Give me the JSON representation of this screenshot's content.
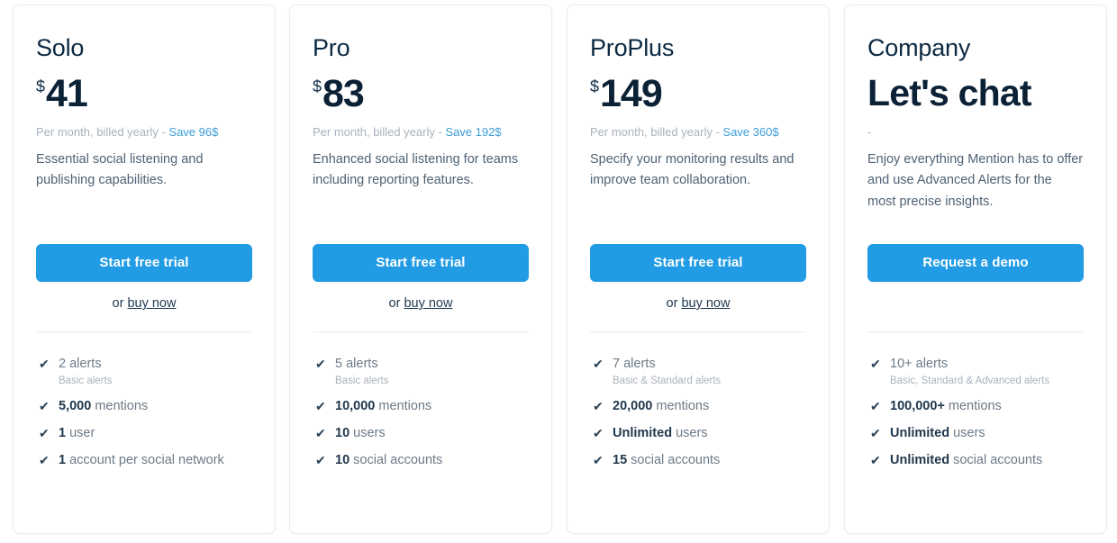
{
  "theme": {
    "button_blue": "#219be4",
    "link_blue": "#3d9dd8",
    "title_navy": "#0d2a43",
    "muted_gray": "#a9b2bd",
    "card_border": "#e8ebef"
  },
  "icons": {
    "check": "check-icon",
    "check_glyph": "✔"
  },
  "plans": [
    {
      "name": "Solo",
      "currency": "$",
      "amount": "41",
      "billing_prefix": "Per month, billed yearly - ",
      "save_label": "Save 96$",
      "description": "Essential social listening and publishing capabilities.",
      "cta_label": "Start free trial",
      "or_prefix": "or ",
      "buy_label": "buy now",
      "features": [
        {
          "value": "2",
          "label": " alerts",
          "sub": "Basic alerts",
          "bold": false
        },
        {
          "value": "5,000",
          "label": " mentions",
          "sub": "",
          "bold": true
        },
        {
          "value": "1",
          "label": " user",
          "sub": "",
          "bold": true
        },
        {
          "value": "1",
          "label": " account per social network",
          "sub": "",
          "bold": true
        }
      ]
    },
    {
      "name": "Pro",
      "currency": "$",
      "amount": "83",
      "billing_prefix": "Per month, billed yearly - ",
      "save_label": "Save 192$",
      "description": "Enhanced social listening for teams including reporting features.",
      "cta_label": "Start free trial",
      "or_prefix": "or ",
      "buy_label": "buy now",
      "features": [
        {
          "value": "5",
          "label": " alerts",
          "sub": "Basic alerts",
          "bold": false
        },
        {
          "value": "10,000",
          "label": " mentions",
          "sub": "",
          "bold": true
        },
        {
          "value": "10",
          "label": " users",
          "sub": "",
          "bold": true
        },
        {
          "value": "10",
          "label": " social accounts",
          "sub": "",
          "bold": true
        }
      ]
    },
    {
      "name": "ProPlus",
      "currency": "$",
      "amount": "149",
      "billing_prefix": "Per month, billed yearly - ",
      "save_label": "Save 360$",
      "description": "Specify your monitoring results and improve team collaboration.",
      "cta_label": "Start free trial",
      "or_prefix": "or ",
      "buy_label": "buy now",
      "features": [
        {
          "value": "7",
          "label": " alerts",
          "sub": "Basic & Standard alerts",
          "bold": false
        },
        {
          "value": "20,000",
          "label": " mentions",
          "sub": "",
          "bold": true
        },
        {
          "value": "Unlimited",
          "label": " users",
          "sub": "",
          "bold": true
        },
        {
          "value": "15",
          "label": " social accounts",
          "sub": "",
          "bold": true
        }
      ]
    },
    {
      "name": "Company",
      "currency": "",
      "amount": "Let's chat",
      "billing_prefix": "-",
      "save_label": "",
      "description": "Enjoy everything Mention has to offer and use Advanced Alerts for the most precise insights.",
      "cta_label": "Request a demo",
      "or_prefix": "",
      "buy_label": "",
      "features": [
        {
          "value": "10+",
          "label": " alerts",
          "sub": "Basic, Standard & Advanced alerts",
          "bold": false
        },
        {
          "value": "100,000+",
          "label": " mentions",
          "sub": "",
          "bold": true
        },
        {
          "value": "Unlimited",
          "label": " users",
          "sub": "",
          "bold": true
        },
        {
          "value": "Unlimited",
          "label": " social accounts",
          "sub": "",
          "bold": true
        }
      ]
    }
  ]
}
